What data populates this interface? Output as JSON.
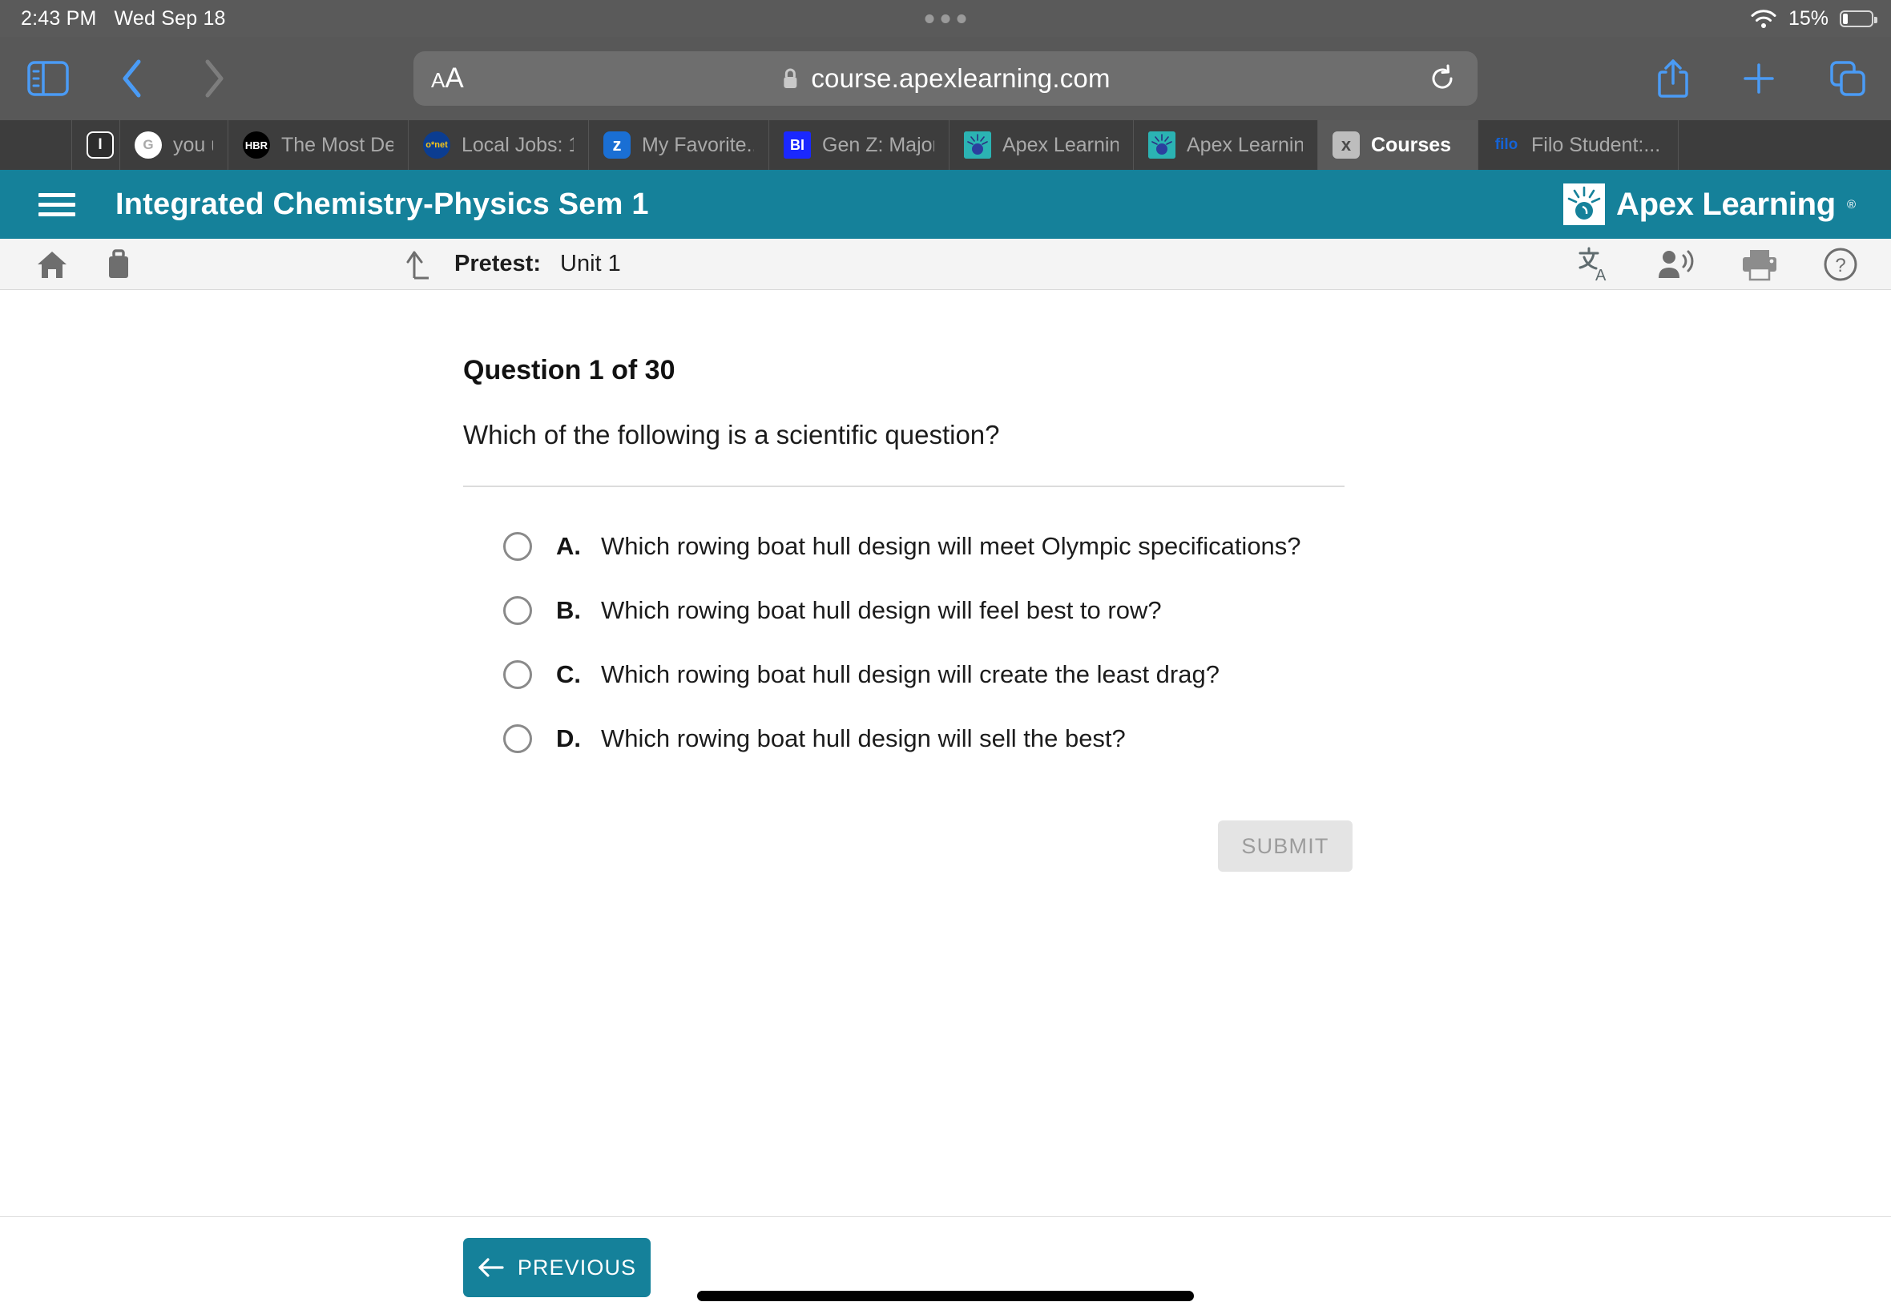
{
  "status_bar": {
    "time": "2:43 PM",
    "date": "Wed Sep 18",
    "battery_percent": "15%",
    "wifi_icon": "wifi-icon",
    "battery_icon": "battery-icon"
  },
  "browser": {
    "sidebar_icon": "sidebar-icon",
    "back_icon": "chevron-left-icon",
    "forward_icon": "chevron-right-icon",
    "aa_small": "A",
    "aa_big": "A",
    "lock_icon": "lock-icon",
    "url": "course.apexlearning.com",
    "reload_icon": "reload-icon",
    "share_icon": "share-icon",
    "new_tab_icon": "plus-icon",
    "tabs_icon": "tabs-overview-icon"
  },
  "tabs": [
    {
      "label": "",
      "favicon": "blank-favicon",
      "glyph": "",
      "active": false
    },
    {
      "label": "",
      "favicon": "instagram-favicon",
      "glyph": "I",
      "active": false
    },
    {
      "label": "you u",
      "favicon": "google-favicon",
      "glyph": "G",
      "active": false
    },
    {
      "label": "The Most De...",
      "favicon": "hbr-favicon",
      "glyph": "HBR",
      "active": false
    },
    {
      "label": "Local Jobs: 1...",
      "favicon": "onet-favicon",
      "glyph": "o*net",
      "active": false
    },
    {
      "label": "My Favorite...",
      "favicon": "zety-favicon",
      "glyph": "z",
      "active": false
    },
    {
      "label": "Gen Z: Major...",
      "favicon": "business-insider-favicon",
      "glyph": "BI",
      "active": false
    },
    {
      "label": "Apex Learning",
      "favicon": "apex-favicon",
      "glyph": "",
      "active": false
    },
    {
      "label": "Apex Learning",
      "favicon": "apex-favicon",
      "glyph": "",
      "active": false
    },
    {
      "label": "Courses",
      "favicon": "x-favicon",
      "glyph": "x",
      "active": true
    },
    {
      "label": "Filo Student:...",
      "favicon": "filo-favicon",
      "glyph": "filo",
      "active": false
    }
  ],
  "app_header": {
    "menu_icon": "hamburger-menu-icon",
    "course_title": "Integrated Chemistry-Physics Sem 1",
    "brand_name": "Apex Learning",
    "brand_mark": "apex-sunburst-logo",
    "registered_mark": "®",
    "background_color": "#15819a"
  },
  "sub_toolbar": {
    "home_icon": "home-icon",
    "briefcase_icon": "briefcase-icon",
    "up_arrow_icon": "arrow-up-left-icon",
    "activity_type": "Pretest:",
    "activity_unit": "Unit 1",
    "translate_icon": "translate-icon",
    "read_aloud_icon": "read-aloud-icon",
    "print_icon": "print-icon",
    "help_icon": "help-circle-icon"
  },
  "question": {
    "heading": "Question 1 of 30",
    "stem": "Which of the following is a scientific question?",
    "choices": [
      {
        "letter": "A.",
        "text": "Which rowing boat hull design will meet Olympic specifications?",
        "selected": false
      },
      {
        "letter": "B.",
        "text": "Which rowing boat hull design will feel best to row?",
        "selected": false
      },
      {
        "letter": "C.",
        "text": "Which rowing boat hull design will create the least drag?",
        "selected": false
      },
      {
        "letter": "D.",
        "text": "Which rowing boat hull design will sell the best?",
        "selected": false
      }
    ],
    "submit_label": "SUBMIT",
    "submit_enabled": false
  },
  "footer": {
    "previous_label": "PREVIOUS",
    "previous_arrow_icon": "arrow-left-icon",
    "button_color": "#15819a"
  }
}
